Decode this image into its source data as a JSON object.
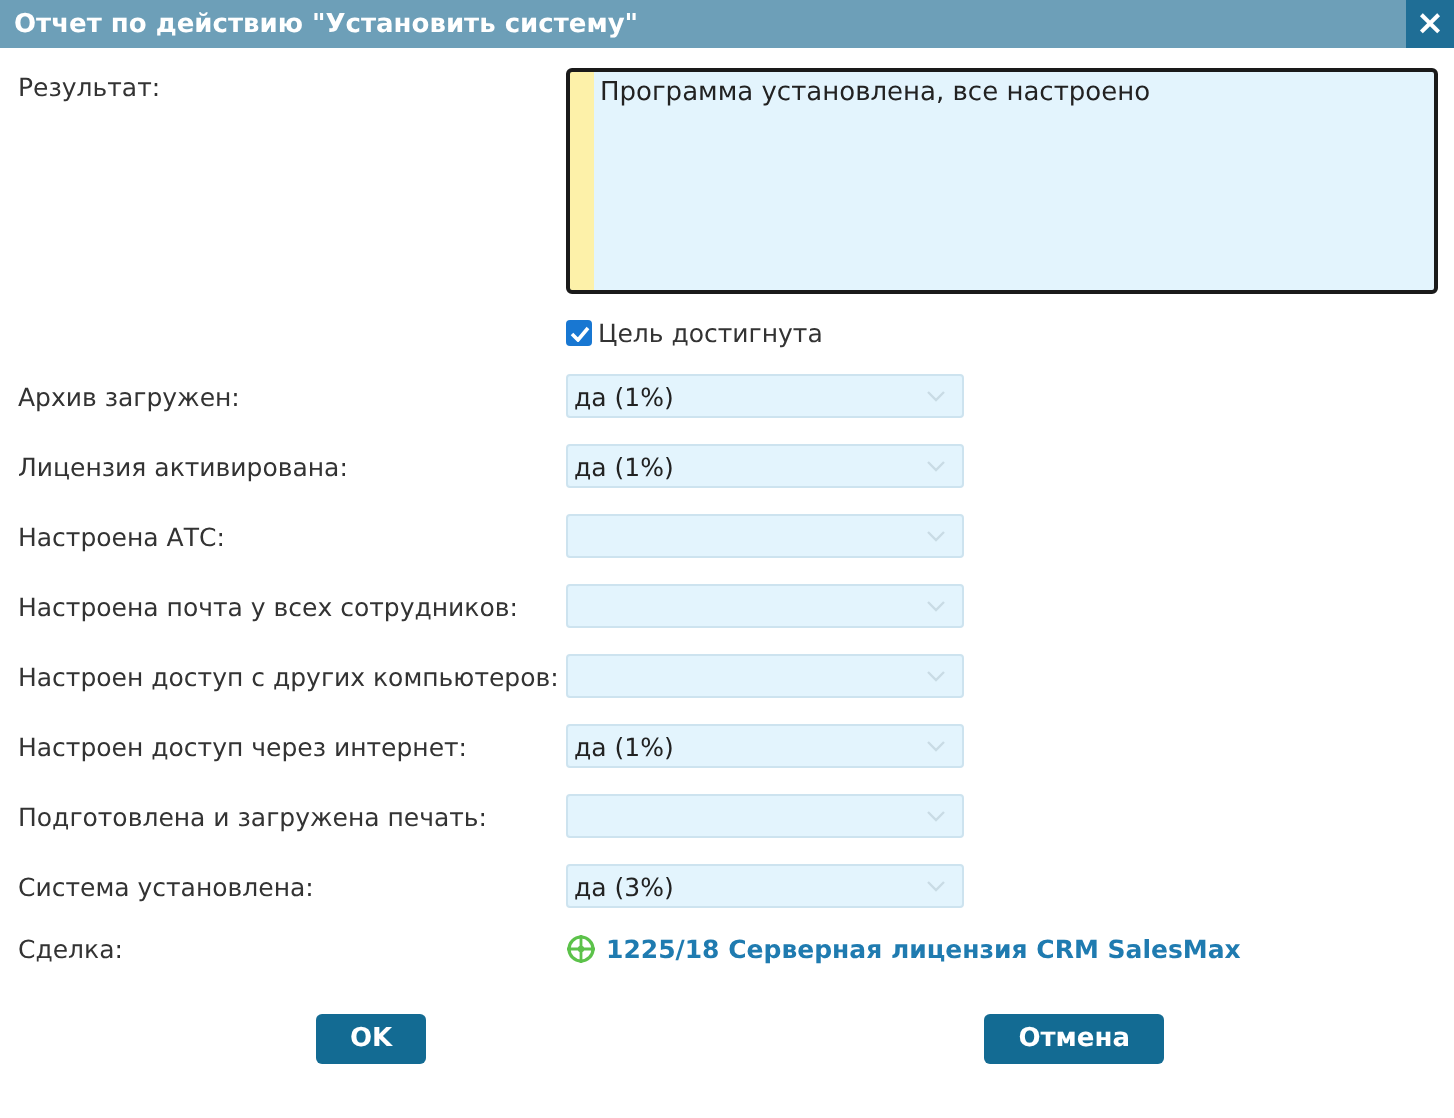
{
  "window": {
    "title": "Отчет по действию \"Установить систему\"",
    "close": "×"
  },
  "result": {
    "label": "Результат:",
    "value": "Программа установлена, все настроено"
  },
  "goal": {
    "label": "Цель достигнута",
    "checked": true
  },
  "fields": [
    {
      "label": "Архив загружен:",
      "value": "да (1%)"
    },
    {
      "label": "Лицензия активирована:",
      "value": "да (1%)"
    },
    {
      "label": "Настроена АТС:"
    },
    {
      "label": "Настроена почта у всех сотрудников:"
    },
    {
      "label": "Настроен доступ с других компьютеров:"
    },
    {
      "label": "Настроен доступ через интернет:",
      "value": "да (1%)"
    },
    {
      "label": "Подготовлена и загружена печать:"
    },
    {
      "label": "Система установлена:",
      "value": "да (3%)"
    }
  ],
  "deal": {
    "label": "Сделка:",
    "link": "1225/18 Серверная лицензия CRM SalesMax"
  },
  "buttons": [
    "OK",
    "Отмена"
  ]
}
